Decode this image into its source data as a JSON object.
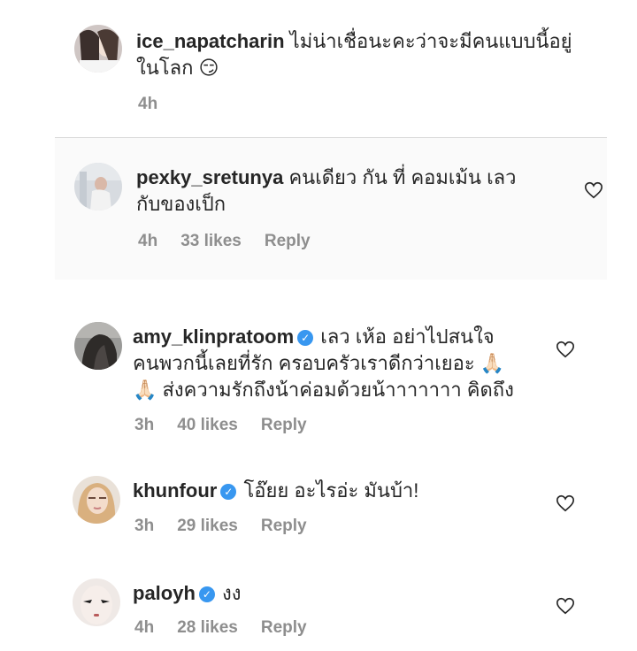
{
  "caption": {
    "username": "ice_napatcharin",
    "text_line1": "ไม่น่าเชื่อนะคะว่าจะมีคนแบบนี้อยู่",
    "text_line2": "ในโลก",
    "emoji": "😏",
    "time": "4h"
  },
  "comments": [
    {
      "username": "pexky_sretunya",
      "text_line1": "คนเดียว กัน ที่ คอมเม้น เลว",
      "text_line2": "กับของเป็ก",
      "time": "4h",
      "likes": "33 likes",
      "reply": "Reply"
    },
    {
      "username": "amy_klinpratoom",
      "text_line1": "เลว เห้อ อย่าไปสนใจ",
      "text_line2": "คนพวกนี้เลยที่รัก ครอบครัวเราดีกว่าเยอะ 🙏🏻",
      "text_line3": "🙏🏻 ส่งความรักถึงน้าค่อมด้วยน้าาาาาาา คิดถึง",
      "time": "3h",
      "likes": "40 likes",
      "reply": "Reply"
    },
    {
      "username": "khunfour",
      "text_line1": "โอ๊ยย อะไรอ่ะ มันบ้า!",
      "time": "3h",
      "likes": "29 likes",
      "reply": "Reply"
    },
    {
      "username": "paloyh",
      "text_line1": "งง",
      "time": "4h",
      "likes": "28 likes",
      "reply": "Reply"
    }
  ],
  "icons": {
    "verified": "✓",
    "heart": "heart-outline-icon"
  },
  "colors": {
    "text": "#262626",
    "meta": "#8e8e8e",
    "verified": "#3897f0",
    "divider": "#dbdbdb"
  }
}
